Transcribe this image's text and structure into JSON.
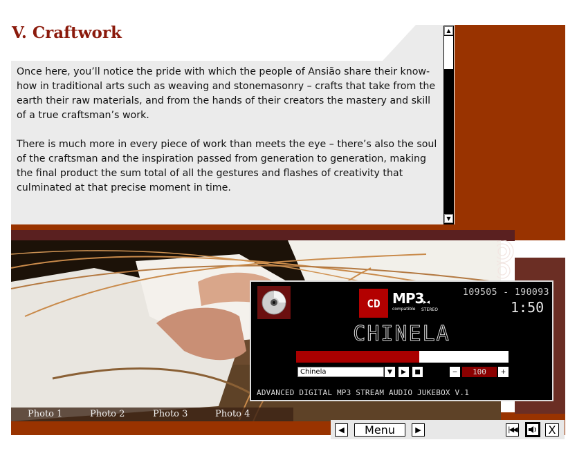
{
  "page": {
    "title": "V. Craftwork",
    "paragraphs": [
      "Once here, you’ll notice the pride with which the people of Ansião share their know-how in traditional arts such as weaving and stonemasonry – crafts that take from the earth their raw materials, and from the hands of their creators the mastery and skill of a true craftsman’s work.",
      "There is much more in every piece of work than meets the eye – there’s also the soul of the craftsman and the inspiration passed from generation to generation, making the final product the sum total of all the gestures and flashes of creativity that culminated at that precise moment in time."
    ]
  },
  "photo_tabs": [
    "Photo 1",
    "Photo 2",
    "Photo 3",
    "Photo 4"
  ],
  "player": {
    "cd_badge": "CD",
    "format_label": "MP3",
    "compatible_label": "compatible",
    "stereo_label": "STEREO",
    "frequency": "109505 - 190093",
    "time": "1:50",
    "song_title": "CHINELA",
    "progress": 0.58,
    "selected_track": "Chinela",
    "volume": "100",
    "footer": "ADVANCED DIGITAL MP3 STREAM AUDIO JUKEBOX V.1"
  },
  "nav": {
    "menu_label": "Menu",
    "close_label": "X"
  },
  "colors": {
    "title": "#8b1a0c",
    "rust": "#993300",
    "player_accent": "#b30000"
  },
  "icons": [
    "scroll-up-icon",
    "scroll-down-icon",
    "cd-disc-icon",
    "stereo-icon",
    "dropdown-arrow-icon",
    "play-icon",
    "stop-icon",
    "minus-icon",
    "plus-icon",
    "prev-arrow-icon",
    "next-arrow-icon",
    "skip-back-icon",
    "speaker-icon"
  ]
}
